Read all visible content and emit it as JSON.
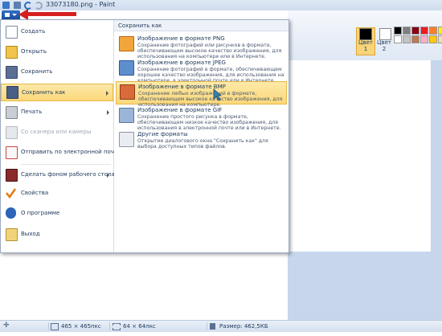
{
  "window": {
    "title": "33073180.png - Paint"
  },
  "ribbon": {
    "color1_label": "Цвет 1",
    "color2_label": "Цвет 2",
    "palette": [
      "#000000",
      "#7f7f7f",
      "#880015",
      "#ed1c24",
      "#ff7f27",
      "#fff200",
      "#22b14c",
      "#ffffff",
      "#c3c3c3",
      "#b97a57",
      "#ffaec9",
      "#ffc90e",
      "#efe4b0",
      "#b5e61d"
    ]
  },
  "menu": {
    "items": [
      {
        "label": "Создать",
        "icon": "new-file-icon"
      },
      {
        "label": "Открыть",
        "icon": "open-folder-icon"
      },
      {
        "label": "Сохранить",
        "icon": "save-disk-icon"
      },
      {
        "label": "Сохранить как",
        "icon": "save-as-icon"
      },
      {
        "label": "Печать",
        "icon": "printer-icon"
      },
      {
        "label": "Со сканера или камеры",
        "icon": "scanner-icon"
      },
      {
        "label": "Отправить по электронной почте",
        "icon": "email-icon"
      },
      {
        "label": "Сделать фоном рабочего стола",
        "icon": "desktop-background-icon"
      },
      {
        "label": "Свойства",
        "icon": "properties-check-icon"
      },
      {
        "label": "О программе",
        "icon": "info-icon"
      },
      {
        "label": "Выход",
        "icon": "exit-icon"
      }
    ]
  },
  "submenu": {
    "header": "Сохранить как",
    "options": [
      {
        "title": "Изображение в формате PNG",
        "desc": "Сохранение фотографий или рисунков в формате, обеспечивающем высокое качество изображения, для использования на компьютере или в Интернете."
      },
      {
        "title": "Изображение в формате JPEG",
        "desc": "Сохранение фотографий в формате, обеспечивающем хорошее качество изображения, для использования на компьютере, в электронной почте или в Интернете."
      },
      {
        "title": "Изображение в формате BMP",
        "desc": "Сохранение любых изображений в формате, обеспечивающем высокое качество изображения, для использования на компьютере."
      },
      {
        "title": "Изображение в формате GIF",
        "desc": "Сохранение простого рисунка в формате, обеспечивающем низкое качество изображения, для использования в электронной почте или в Интернете."
      },
      {
        "title": "Другие форматы",
        "desc": "Открытие диалогового окна \"Сохранить как\" для выбора доступных типов файлов."
      }
    ]
  },
  "status": {
    "image_size": "465 × 465пкс",
    "selection_size": "64 × 64пкс",
    "file_size": "Размер: 462,5КБ"
  }
}
